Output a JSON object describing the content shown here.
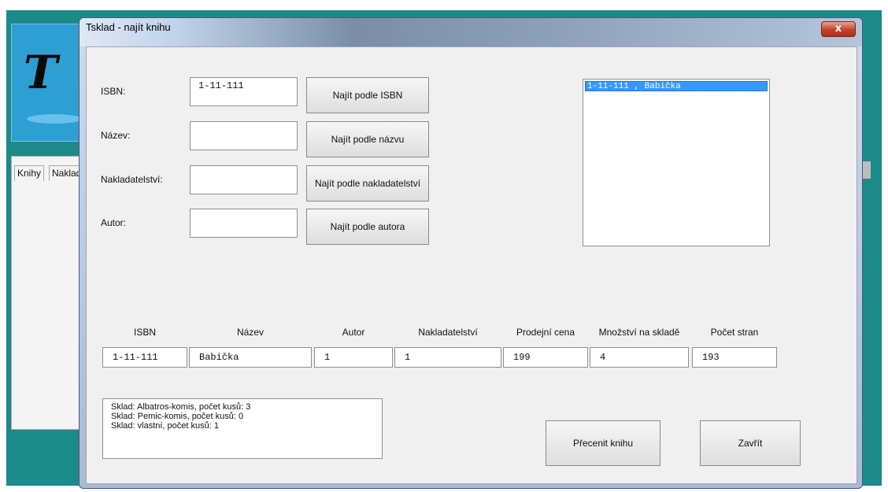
{
  "parent_window": {
    "logo_letter": "T",
    "tabs": [
      "Knihy",
      "Naklad"
    ]
  },
  "dialog": {
    "title": "Tsklad - najít knihu",
    "close_label": "x"
  },
  "search": {
    "isbn_label": "ISBN:",
    "isbn_value": "1-11-111",
    "nazev_label": "Název:",
    "nazev_value": "",
    "nakladatelstvi_label": "Nakladatelství:",
    "nakladatelstvi_value": "",
    "autor_label": "Autor:",
    "autor_value": "",
    "buttons": {
      "by_isbn": "Najít podle ISBN",
      "by_nazev": "Najít podle názvu",
      "by_nakladatelstvi": "Najít podle nakladatelství",
      "by_autor": "Najít podle autora"
    }
  },
  "results_list": {
    "items": [
      "1-11-111 , Babička"
    ],
    "selected_index": 0
  },
  "detail": {
    "headers": [
      "ISBN",
      "Název",
      "Autor",
      "Nakladatelství",
      "Prodejní cena",
      "Množství na skladě",
      "Počet stran"
    ],
    "values": [
      "1-11-111",
      "Babička",
      "1",
      "1",
      "199",
      "4",
      "193"
    ]
  },
  "stock": {
    "lines": [
      "Sklad: Albatros-komis, počet kusů: 3",
      "Sklad: Pemic-komis, počet kusů: 0",
      "Sklad: vlastní, počet kusů: 1"
    ]
  },
  "actions": {
    "reprice_label": "Přecenit knihu",
    "close_label": "Zavřít"
  },
  "colors": {
    "desktop": "#1d8a8a",
    "selection": "#3399ff",
    "client_bg": "#f0f0f0"
  }
}
